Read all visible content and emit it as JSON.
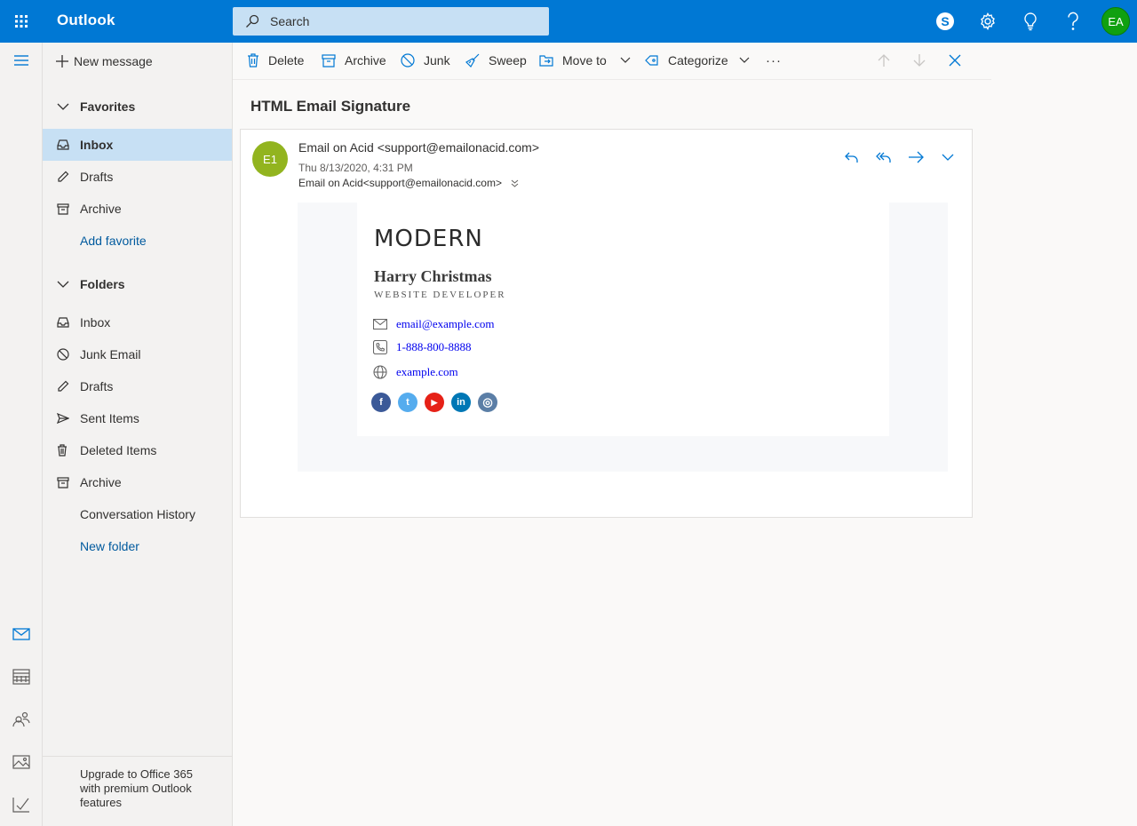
{
  "app": {
    "title": "Outlook"
  },
  "search": {
    "placeholder": "Search"
  },
  "user": {
    "initials": "EA"
  },
  "toolbar": {
    "new_message": "New message",
    "delete": "Delete",
    "archive": "Archive",
    "junk": "Junk",
    "sweep": "Sweep",
    "move_to": "Move to",
    "categorize": "Categorize",
    "more": "···"
  },
  "favorites": {
    "heading": "Favorites",
    "items": [
      {
        "label": "Inbox",
        "icon": "inbox-icon",
        "selected": true
      },
      {
        "label": "Drafts",
        "icon": "pencil-icon"
      },
      {
        "label": "Archive",
        "icon": "archive-icon"
      }
    ],
    "add_favorite": "Add favorite"
  },
  "folders": {
    "heading": "Folders",
    "items": [
      {
        "label": "Inbox",
        "icon": "inbox-icon"
      },
      {
        "label": "Junk Email",
        "icon": "block-icon"
      },
      {
        "label": "Drafts",
        "icon": "pencil-icon"
      },
      {
        "label": "Sent Items",
        "icon": "send-icon"
      },
      {
        "label": "Deleted Items",
        "icon": "trash-icon"
      },
      {
        "label": "Archive",
        "icon": "archive-icon"
      },
      {
        "label": "Conversation History",
        "icon": ""
      }
    ],
    "new_folder": "New folder"
  },
  "upgrade": {
    "text": "Upgrade to Office 365 with premium Outlook features"
  },
  "message": {
    "subject": "HTML Email Signature",
    "avatar": "E1",
    "from": "Email on Acid <support@emailonacid.com>",
    "datetime": "Thu 8/13/2020, 4:31 PM",
    "to": "Email on Acid<support@emailonacid.com>"
  },
  "signature": {
    "logo": "MODERN",
    "name": "Harry Christmas",
    "title": "WEBSITE DEVELOPER",
    "email": "email@example.com",
    "phone": "1-888-800-8888",
    "website": "example.com",
    "socials": [
      {
        "name": "facebook",
        "glyph": "f",
        "color": "#3b5998"
      },
      {
        "name": "twitter",
        "glyph": "t",
        "color": "#55acee"
      },
      {
        "name": "youtube",
        "glyph": "▶",
        "color": "#e62117"
      },
      {
        "name": "linkedin",
        "glyph": "in",
        "color": "#0077b5"
      },
      {
        "name": "instagram",
        "glyph": "◎",
        "color": "#5b7ea6"
      }
    ]
  },
  "colors": {
    "brand": "#0078d4",
    "selected": "#c7e0f4",
    "link": "#005a9e"
  }
}
